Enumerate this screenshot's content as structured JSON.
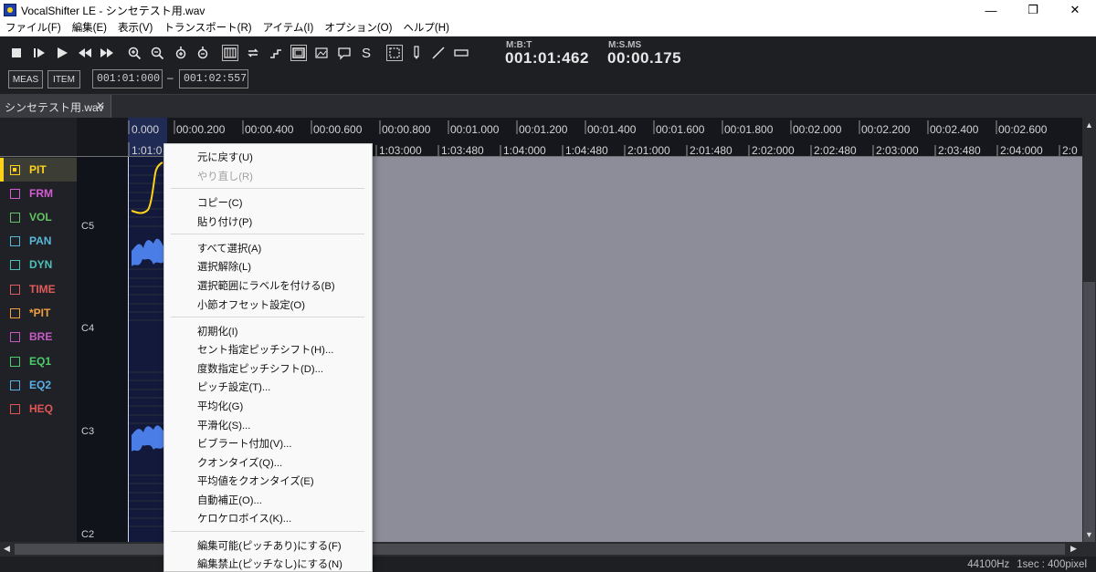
{
  "window": {
    "title": "VocalShifter LE - シンセテスト用.wav",
    "minimize": "—",
    "restore": "❐",
    "close": "✕"
  },
  "menubar": [
    "ファイル(F)",
    "編集(E)",
    "表示(V)",
    "トランスポート(R)",
    "アイテム(I)",
    "オプション(O)",
    "ヘルプ(H)"
  ],
  "toolbar": {
    "meas_label": "MEAS",
    "item_label": "ITEM",
    "range_start": "001:01:000",
    "range_sep": "–",
    "range_end": "001:02:557",
    "s_label": "S"
  },
  "readouts": {
    "mbt_label": "M:B:T",
    "mbt_value": "001:01:462",
    "msms_label": "M:S.MS",
    "msms_value": "00:00.175"
  },
  "tab": {
    "label": "シンセテスト用.wav",
    "close": "✕"
  },
  "tracks": [
    {
      "label": "PIT",
      "color": "#ffd21a",
      "active": true
    },
    {
      "label": "FRM",
      "color": "#d45cd4"
    },
    {
      "label": "VOL",
      "color": "#62c462"
    },
    {
      "label": "PAN",
      "color": "#58b8d8"
    },
    {
      "label": "DYN",
      "color": "#4cc0b8"
    },
    {
      "label": "TIME",
      "color": "#e05b5b"
    },
    {
      "label": "*PIT",
      "color": "#f0a040"
    },
    {
      "label": "BRE",
      "color": "#c55ac5"
    },
    {
      "label": "EQ1",
      "color": "#4ccc6a"
    },
    {
      "label": "EQ2",
      "color": "#5ab0e6"
    },
    {
      "label": "HEQ",
      "color": "#e05555"
    }
  ],
  "ruler": {
    "time": [
      "0.000",
      "00:00.200",
      "00:00.400",
      "00:00.600",
      "00:00.800",
      "00:01.000",
      "00:01.200",
      "00:01.400",
      "00:01.600",
      "00:01.800",
      "00:02.000",
      "00:02.200",
      "00:02.400",
      "00:02.600"
    ],
    "measure": [
      "1:01:0",
      "1:03:000",
      "1:03:480",
      "1:04:000",
      "1:04:480",
      "2:01:000",
      "2:01:480",
      "2:02:000",
      "2:02:480",
      "2:03:000",
      "2:03:480",
      "2:04:000",
      "2:0"
    ]
  },
  "pitch_labels": [
    "C5",
    "C4",
    "C3",
    "C2"
  ],
  "status": {
    "rate": "44100Hz",
    "scale": "1sec : 400pixel"
  },
  "context_menu": {
    "undo": "元に戻す(U)",
    "redo": "やり直し(R)",
    "copy": "コピー(C)",
    "paste": "貼り付け(P)",
    "select_all": "すべて選択(A)",
    "deselect": "選択解除(L)",
    "label_range": "選択範囲にラベルを付ける(B)",
    "bar_offset": "小節オフセット設定(O)",
    "initialize": "初期化(I)",
    "cent_shift": "セント指定ピッチシフト(H)...",
    "degree_shift": "度数指定ピッチシフト(D)...",
    "pitch_set": "ピッチ設定(T)...",
    "average": "平均化(G)",
    "smooth": "平滑化(S)...",
    "vibrato": "ビブラート付加(V)...",
    "quantize": "クオンタイズ(Q)...",
    "avg_quantize": "平均値をクオンタイズ(E)",
    "auto_correct": "自動補正(O)...",
    "kerokero": "ケロケロボイス(K)...",
    "editable": "編集可能(ピッチあり)にする(F)",
    "locked": "編集禁止(ピッチなし)にする(N)"
  }
}
